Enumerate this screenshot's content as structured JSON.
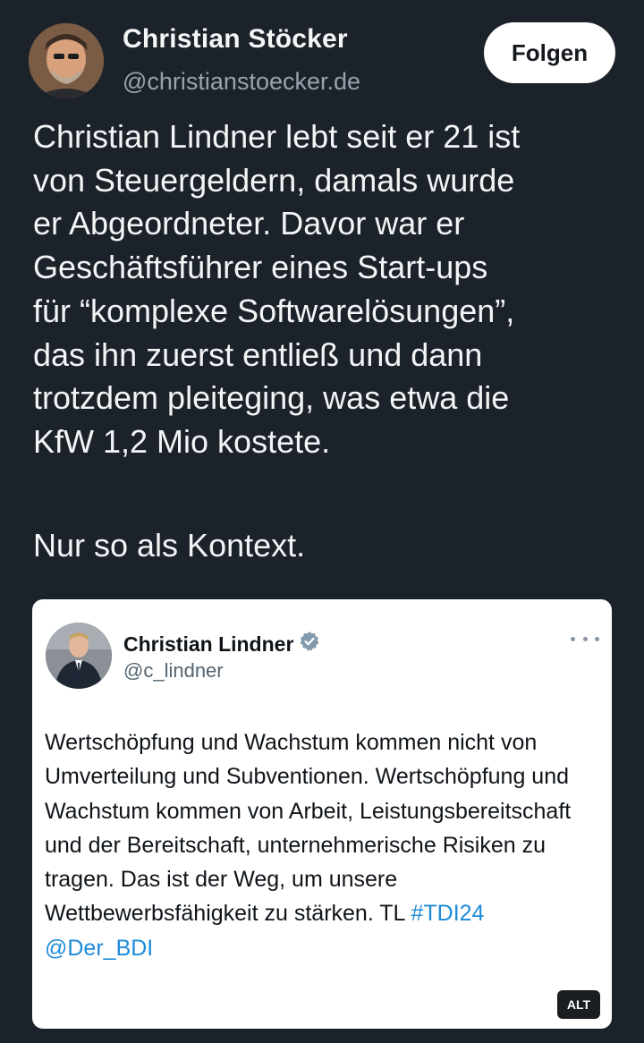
{
  "author": {
    "display_name": "Christian Stöcker",
    "handle": "@christianstoecker.de"
  },
  "follow_label": "Folgen",
  "post": {
    "text": "Christian Lindner lebt seit er 21 ist\nvon Steuergeldern, damals wurde\ner Abgeordneter. Davor war er\nGeschäftsführer eines Start-ups\nfür “komplexe Softwarelösungen”,\ndas ihn zuerst entließ und dann\ntrotzdem pleiteging, was etwa die\nKfW 1,2 Mio kostete.",
    "text2": "Nur so als Kontext."
  },
  "quoted": {
    "display_name": "Christian Lindner",
    "verified_icon": "verified-badge-icon",
    "handle": "@c_lindner",
    "text": "Wertschöpfung und Wachstum kommen nicht von Umverteilung und Subventionen. Wertschöpfung und Wachstum kommen von Arbeit, Leistungsbereitschaft und der Bereitschaft, unternehmerische Risiken zu tragen. Das ist der Weg, um unsere Wettbewerbsfähigkeit zu stärken. TL ",
    "hashtag": "#TDI24",
    "mention": "@Der_BDI",
    "alt_badge": "ALT"
  },
  "colors": {
    "background": "#1c222a",
    "link": "#1d8bd8",
    "verified": "#829aab"
  }
}
